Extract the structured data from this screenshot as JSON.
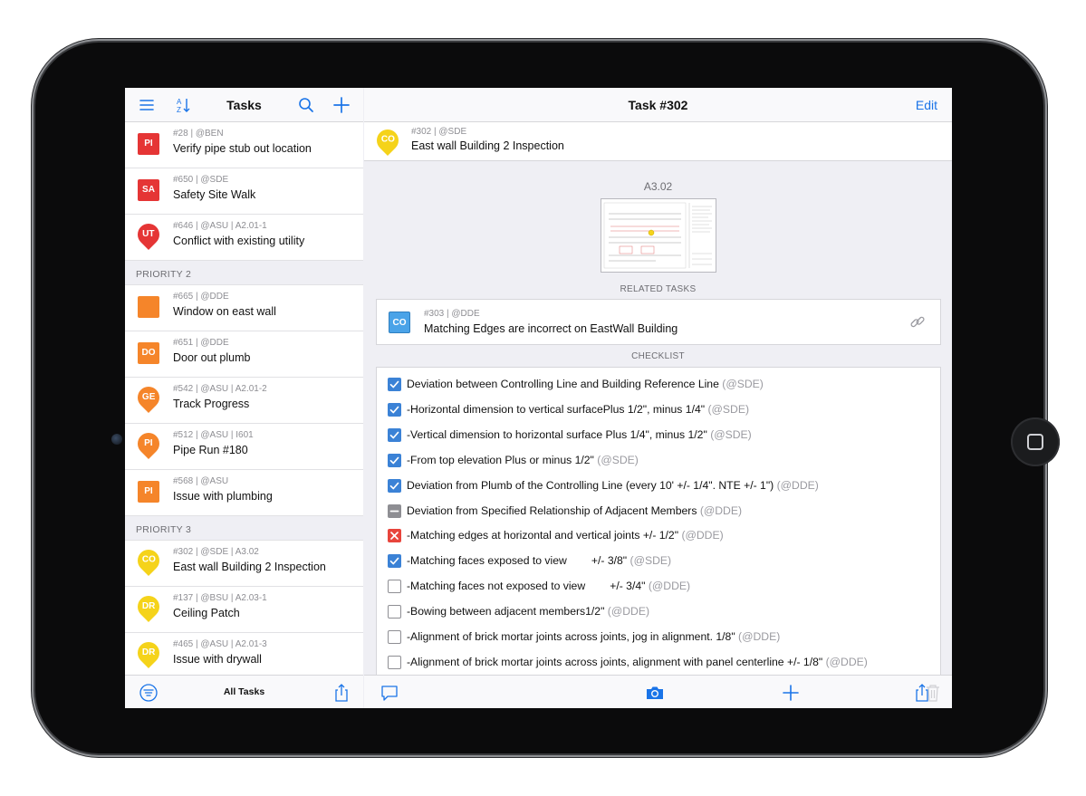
{
  "left": {
    "title": "Tasks",
    "footer_label": "All Tasks",
    "rows": [
      {
        "type": "task",
        "meta": "#28 | @BEN",
        "name": "Verify pipe stub out location",
        "code": "PI",
        "shape": "square",
        "color": "#e53535"
      },
      {
        "type": "task",
        "meta": "#650 | @SDE",
        "name": "Safety Site Walk",
        "code": "SA",
        "shape": "square",
        "color": "#e53535"
      },
      {
        "type": "task",
        "meta": "#646 | @ASU | A2.01-1",
        "name": "Conflict with existing utility",
        "code": "UT",
        "shape": "pin",
        "color": "#e53535"
      },
      {
        "type": "section",
        "label": "PRIORITY 2"
      },
      {
        "type": "task",
        "meta": "#665 | @DDE",
        "name": "Window on east wall",
        "code": "",
        "shape": "square",
        "color": "#f5852a"
      },
      {
        "type": "task",
        "meta": "#651 | @DDE",
        "name": "Door out plumb",
        "code": "DO",
        "shape": "square",
        "color": "#f5852a"
      },
      {
        "type": "task",
        "meta": "#542 | @ASU | A2.01-2",
        "name": "Track Progress",
        "code": "GE",
        "shape": "pin",
        "color": "#f5852a"
      },
      {
        "type": "task",
        "meta": "#512 | @ASU | I601",
        "name": "Pipe Run #180",
        "code": "PI",
        "shape": "pin",
        "color": "#f5852a"
      },
      {
        "type": "task",
        "meta": "#568 | @ASU",
        "name": "Issue with plumbing",
        "code": "PI",
        "shape": "square",
        "color": "#f5852a"
      },
      {
        "type": "section",
        "label": "PRIORITY 3"
      },
      {
        "type": "task",
        "meta": "#302 | @SDE | A3.02",
        "name": "East wall Building 2 Inspection",
        "code": "CO",
        "shape": "pin",
        "color": "#f5d31a"
      },
      {
        "type": "task",
        "meta": "#137 | @BSU | A2.03-1",
        "name": "Ceiling Patch",
        "code": "DR",
        "shape": "pin",
        "color": "#f5d31a"
      },
      {
        "type": "task",
        "meta": "#465 | @ASU | A2.01-3",
        "name": "Issue with drywall",
        "code": "DR",
        "shape": "pin",
        "color": "#f5d31a"
      }
    ]
  },
  "detail": {
    "title": "Task #302",
    "edit_label": "Edit",
    "current": {
      "meta": "#302 | @SDE",
      "name": "East wall Building 2 Inspection",
      "code": "CO",
      "color": "#f5d31a"
    },
    "sheet": "A3.02",
    "related_title": "RELATED TASKS",
    "related": {
      "meta": "#303 | @DDE",
      "name": "Matching Edges are incorrect on EastWall Building",
      "code": "CO",
      "color": "#4aa3e8"
    },
    "checklist_title": "CHECKLIST",
    "checklist": [
      {
        "state": "checked",
        "text": "Deviation between Controlling Line and Building Reference Line",
        "who": "(@SDE)"
      },
      {
        "state": "checked",
        "text": "-Horizontal dimension to vertical surfacePlus 1/2\", minus 1/4\"",
        "who": "(@SDE)"
      },
      {
        "state": "checked",
        "text": "-Vertical dimension to horizontal surface Plus 1/4\", minus 1/2\"",
        "who": "(@SDE)"
      },
      {
        "state": "checked",
        "text": "-From top elevation Plus or minus 1/2\"",
        "who": "(@SDE)"
      },
      {
        "state": "checked",
        "text": "Deviation from Plumb of the Controlling Line (every 10' +/- 1/4\". NTE +/- 1\")",
        "who": "(@DDE)"
      },
      {
        "state": "blocked",
        "text": "Deviation from Specified Relationship of Adjacent Members",
        "who": "(@DDE)"
      },
      {
        "state": "failed",
        "text": "-Matching edges at horizontal and vertical joints +/- 1/2\"",
        "who": "(@DDE)"
      },
      {
        "state": "checked",
        "text": "-Matching faces exposed to view        +/- 3/8\"",
        "who": "(@SDE)"
      },
      {
        "state": "empty",
        "text": "-Matching faces not exposed to view        +/- 3/4\"",
        "who": "(@DDE)"
      },
      {
        "state": "empty",
        "text": "-Bowing between adjacent members1/2\"",
        "who": "(@DDE)"
      },
      {
        "state": "empty",
        "text": "-Alignment of brick mortar joints across joints, jog in alignment. 1/8\"",
        "who": "(@DDE)"
      },
      {
        "state": "empty",
        "text": "-Alignment of brick mortar joints across joints, alignment with panel centerline +/- 1/8\"",
        "who": "(@DDE)"
      }
    ]
  },
  "colors": {
    "accent": "#1a74e8",
    "checked": "#3b82d6",
    "failed": "#e8453c"
  }
}
